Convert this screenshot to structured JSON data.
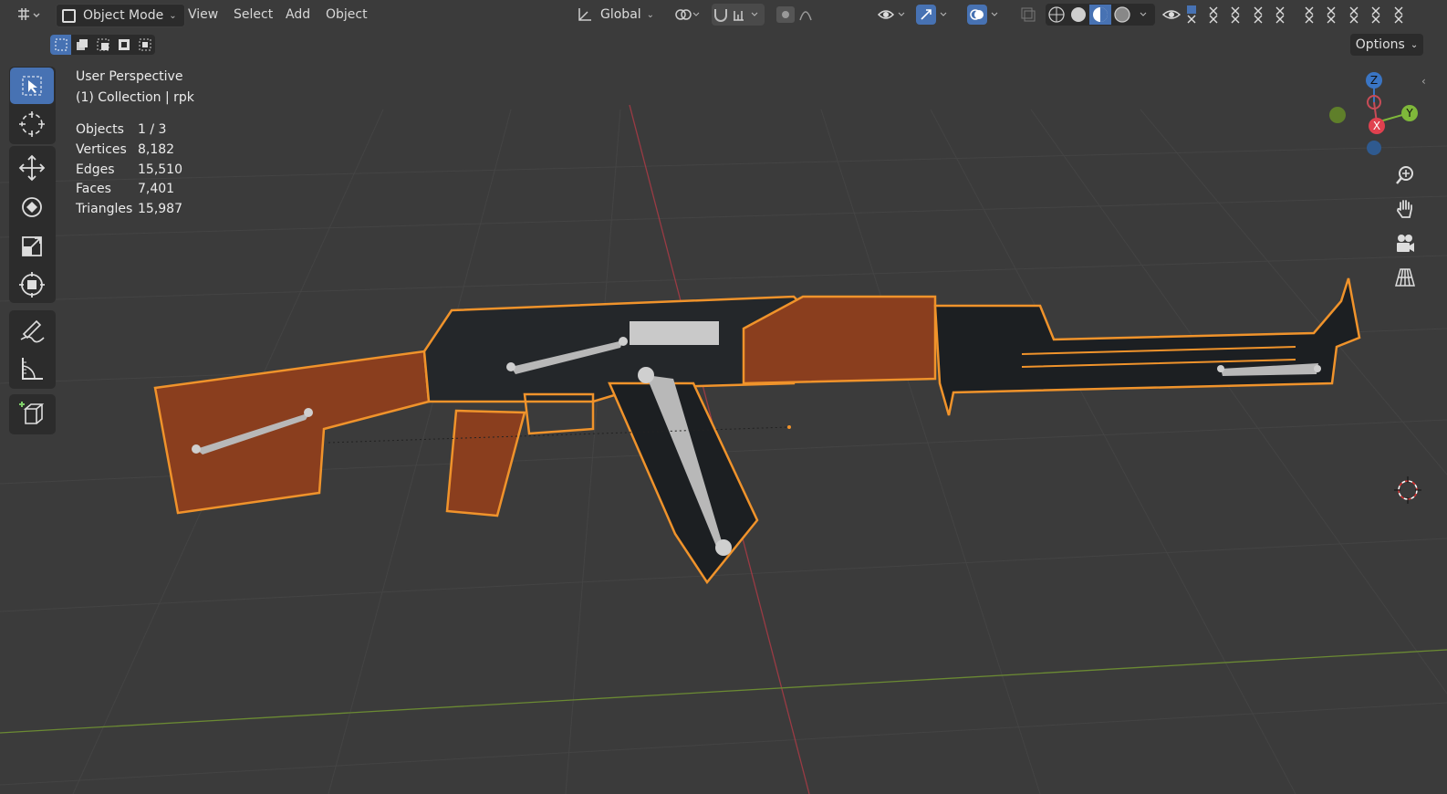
{
  "header": {
    "mode": "Object Mode",
    "menus": [
      "View",
      "Select",
      "Add",
      "Object"
    ],
    "transform_orientation": "Global",
    "options_label": "Options"
  },
  "overlay": {
    "view_name": "User Perspective",
    "collection": "(1) Collection | rpk",
    "stats": [
      {
        "label": "Objects",
        "value": "1 / 3"
      },
      {
        "label": "Vertices",
        "value": "8,182"
      },
      {
        "label": "Edges",
        "value": "15,510"
      },
      {
        "label": "Faces",
        "value": "7,401"
      },
      {
        "label": "Triangles",
        "value": "15,987"
      }
    ]
  },
  "gizmo": {
    "z": "Z",
    "y": "Y",
    "x": "X"
  },
  "colors": {
    "viewport_bg": "#3b3b3b",
    "grid": "#454545",
    "x_axis": "#9a3b44",
    "y_axis": "#6b8a33",
    "selection_outline": "#f0932b",
    "active_blue": "#4772b3",
    "wood": "#8a3e1e",
    "metal": "#1c1f22"
  },
  "tools": [
    "select-box-tool",
    "cursor-tool",
    "move-tool",
    "rotate-tool",
    "scale-tool",
    "transform-tool",
    "annotate-tool",
    "measure-tool",
    "add-cube-tool"
  ]
}
